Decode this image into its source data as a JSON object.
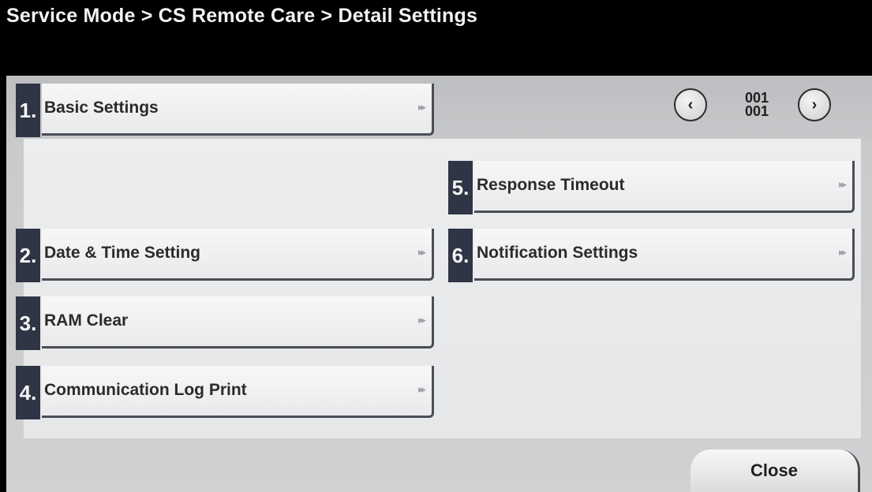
{
  "header": {
    "breadcrumb": "Service Mode > CS Remote Care > Detail Settings"
  },
  "pager": {
    "prev_icon": "chevron-left-icon",
    "next_icon": "chevron-right-icon",
    "prev_glyph": "‹",
    "next_glyph": "›",
    "current_page": "001",
    "total_pages": "001"
  },
  "menu": {
    "items": [
      {
        "number": "1.",
        "label": "Basic Settings"
      },
      {
        "number": "2.",
        "label": "Date & Time Setting"
      },
      {
        "number": "3.",
        "label": "RAM Clear"
      },
      {
        "number": "4.",
        "label": "Communication Log Print"
      },
      {
        "number": "5.",
        "label": "Response Timeout"
      },
      {
        "number": "6.",
        "label": "Notification Settings"
      }
    ],
    "arrow_glyph": "▸▸",
    "arrow_icon": "double-chevron-right-icon"
  },
  "footer": {
    "close_label": "Close"
  },
  "colors": {
    "title_bar": "#000000",
    "panel": "#c9cacc",
    "content": "#e8e9eb",
    "number_badge": "#2f3545",
    "button_face": "#f2f2f3"
  }
}
